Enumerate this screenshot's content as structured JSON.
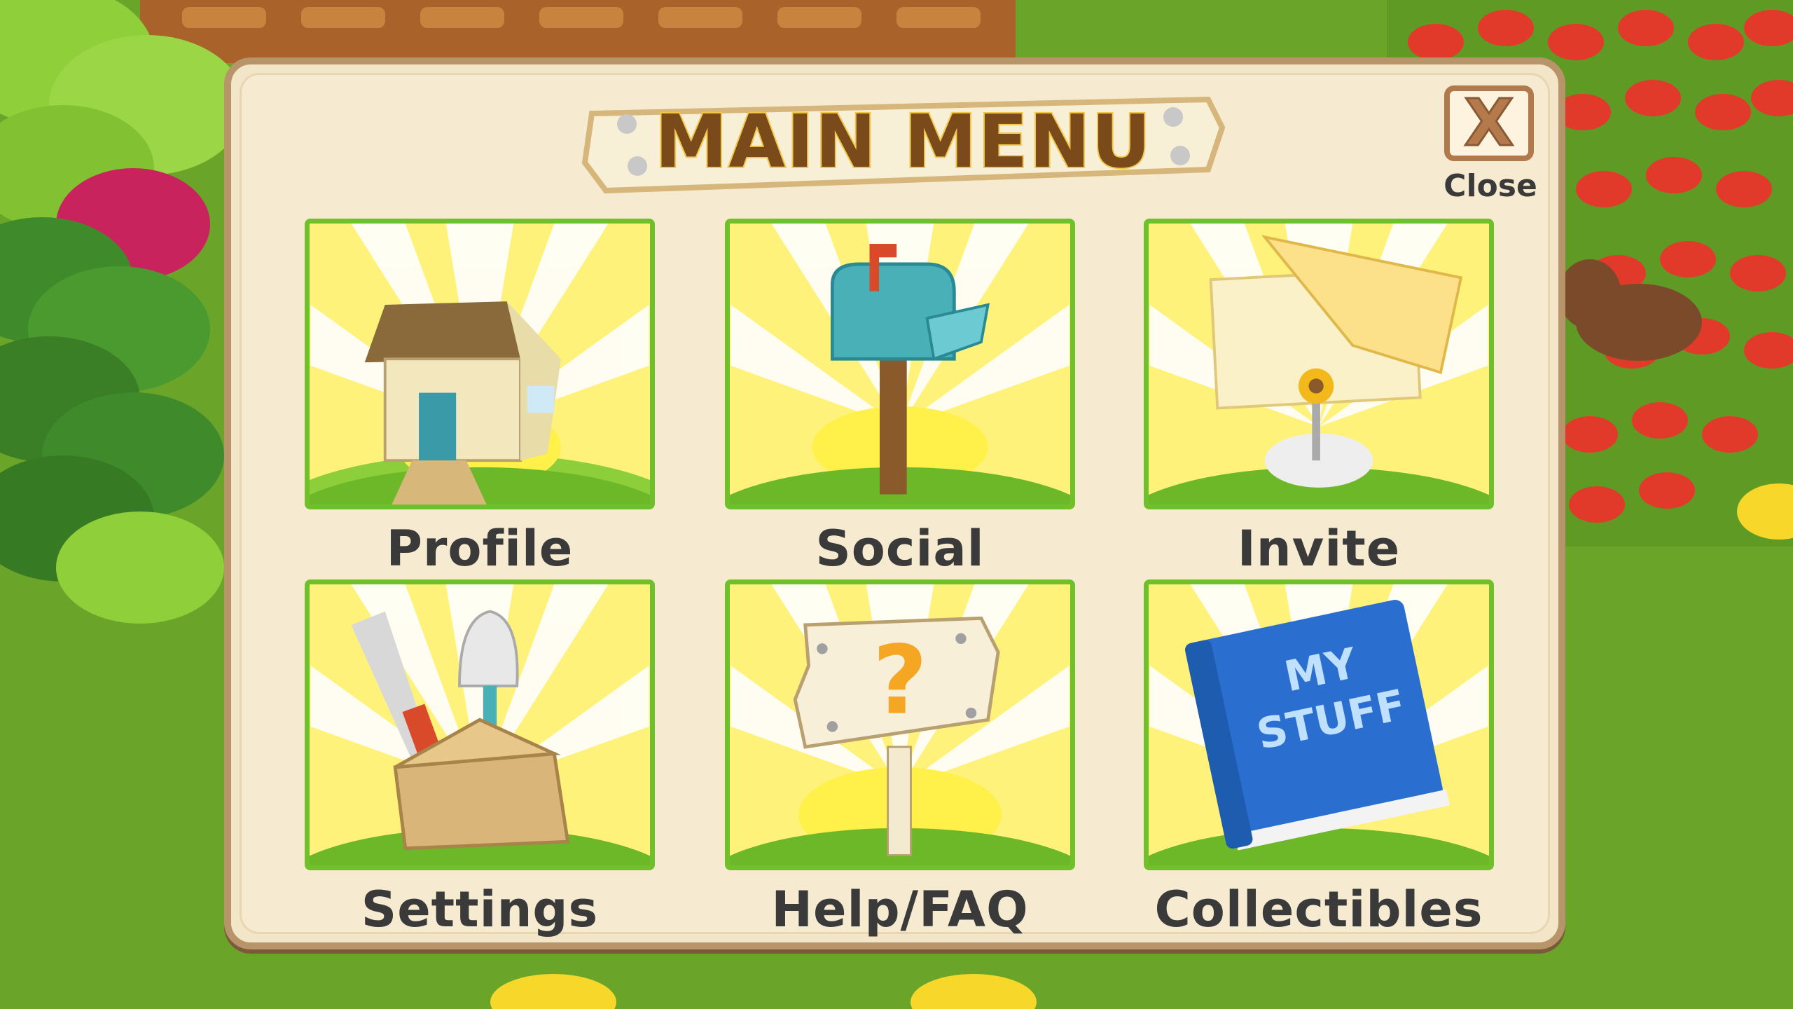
{
  "menu": {
    "title": "MAIN MENU",
    "close_label": "Close",
    "close_glyph": "X",
    "items": [
      {
        "label": "Profile",
        "icon": "house-icon"
      },
      {
        "label": "Social",
        "icon": "mailbox-icon"
      },
      {
        "label": "Invite",
        "icon": "invitation-icon"
      },
      {
        "label": "Settings",
        "icon": "toolbox-icon"
      },
      {
        "label": "Help/FAQ",
        "icon": "question-sign-icon"
      },
      {
        "label": "Collectibles",
        "icon": "book-icon"
      }
    ],
    "book_text": [
      "MY",
      "STUFF"
    ]
  },
  "colors": {
    "panel": "#f3e6c8",
    "panel_border": "#b8946a",
    "tile_border": "#6fc02a",
    "tile_bg": "#fff27a",
    "label_text": "#3a3a3a",
    "title_text": "#7a4a1a"
  }
}
